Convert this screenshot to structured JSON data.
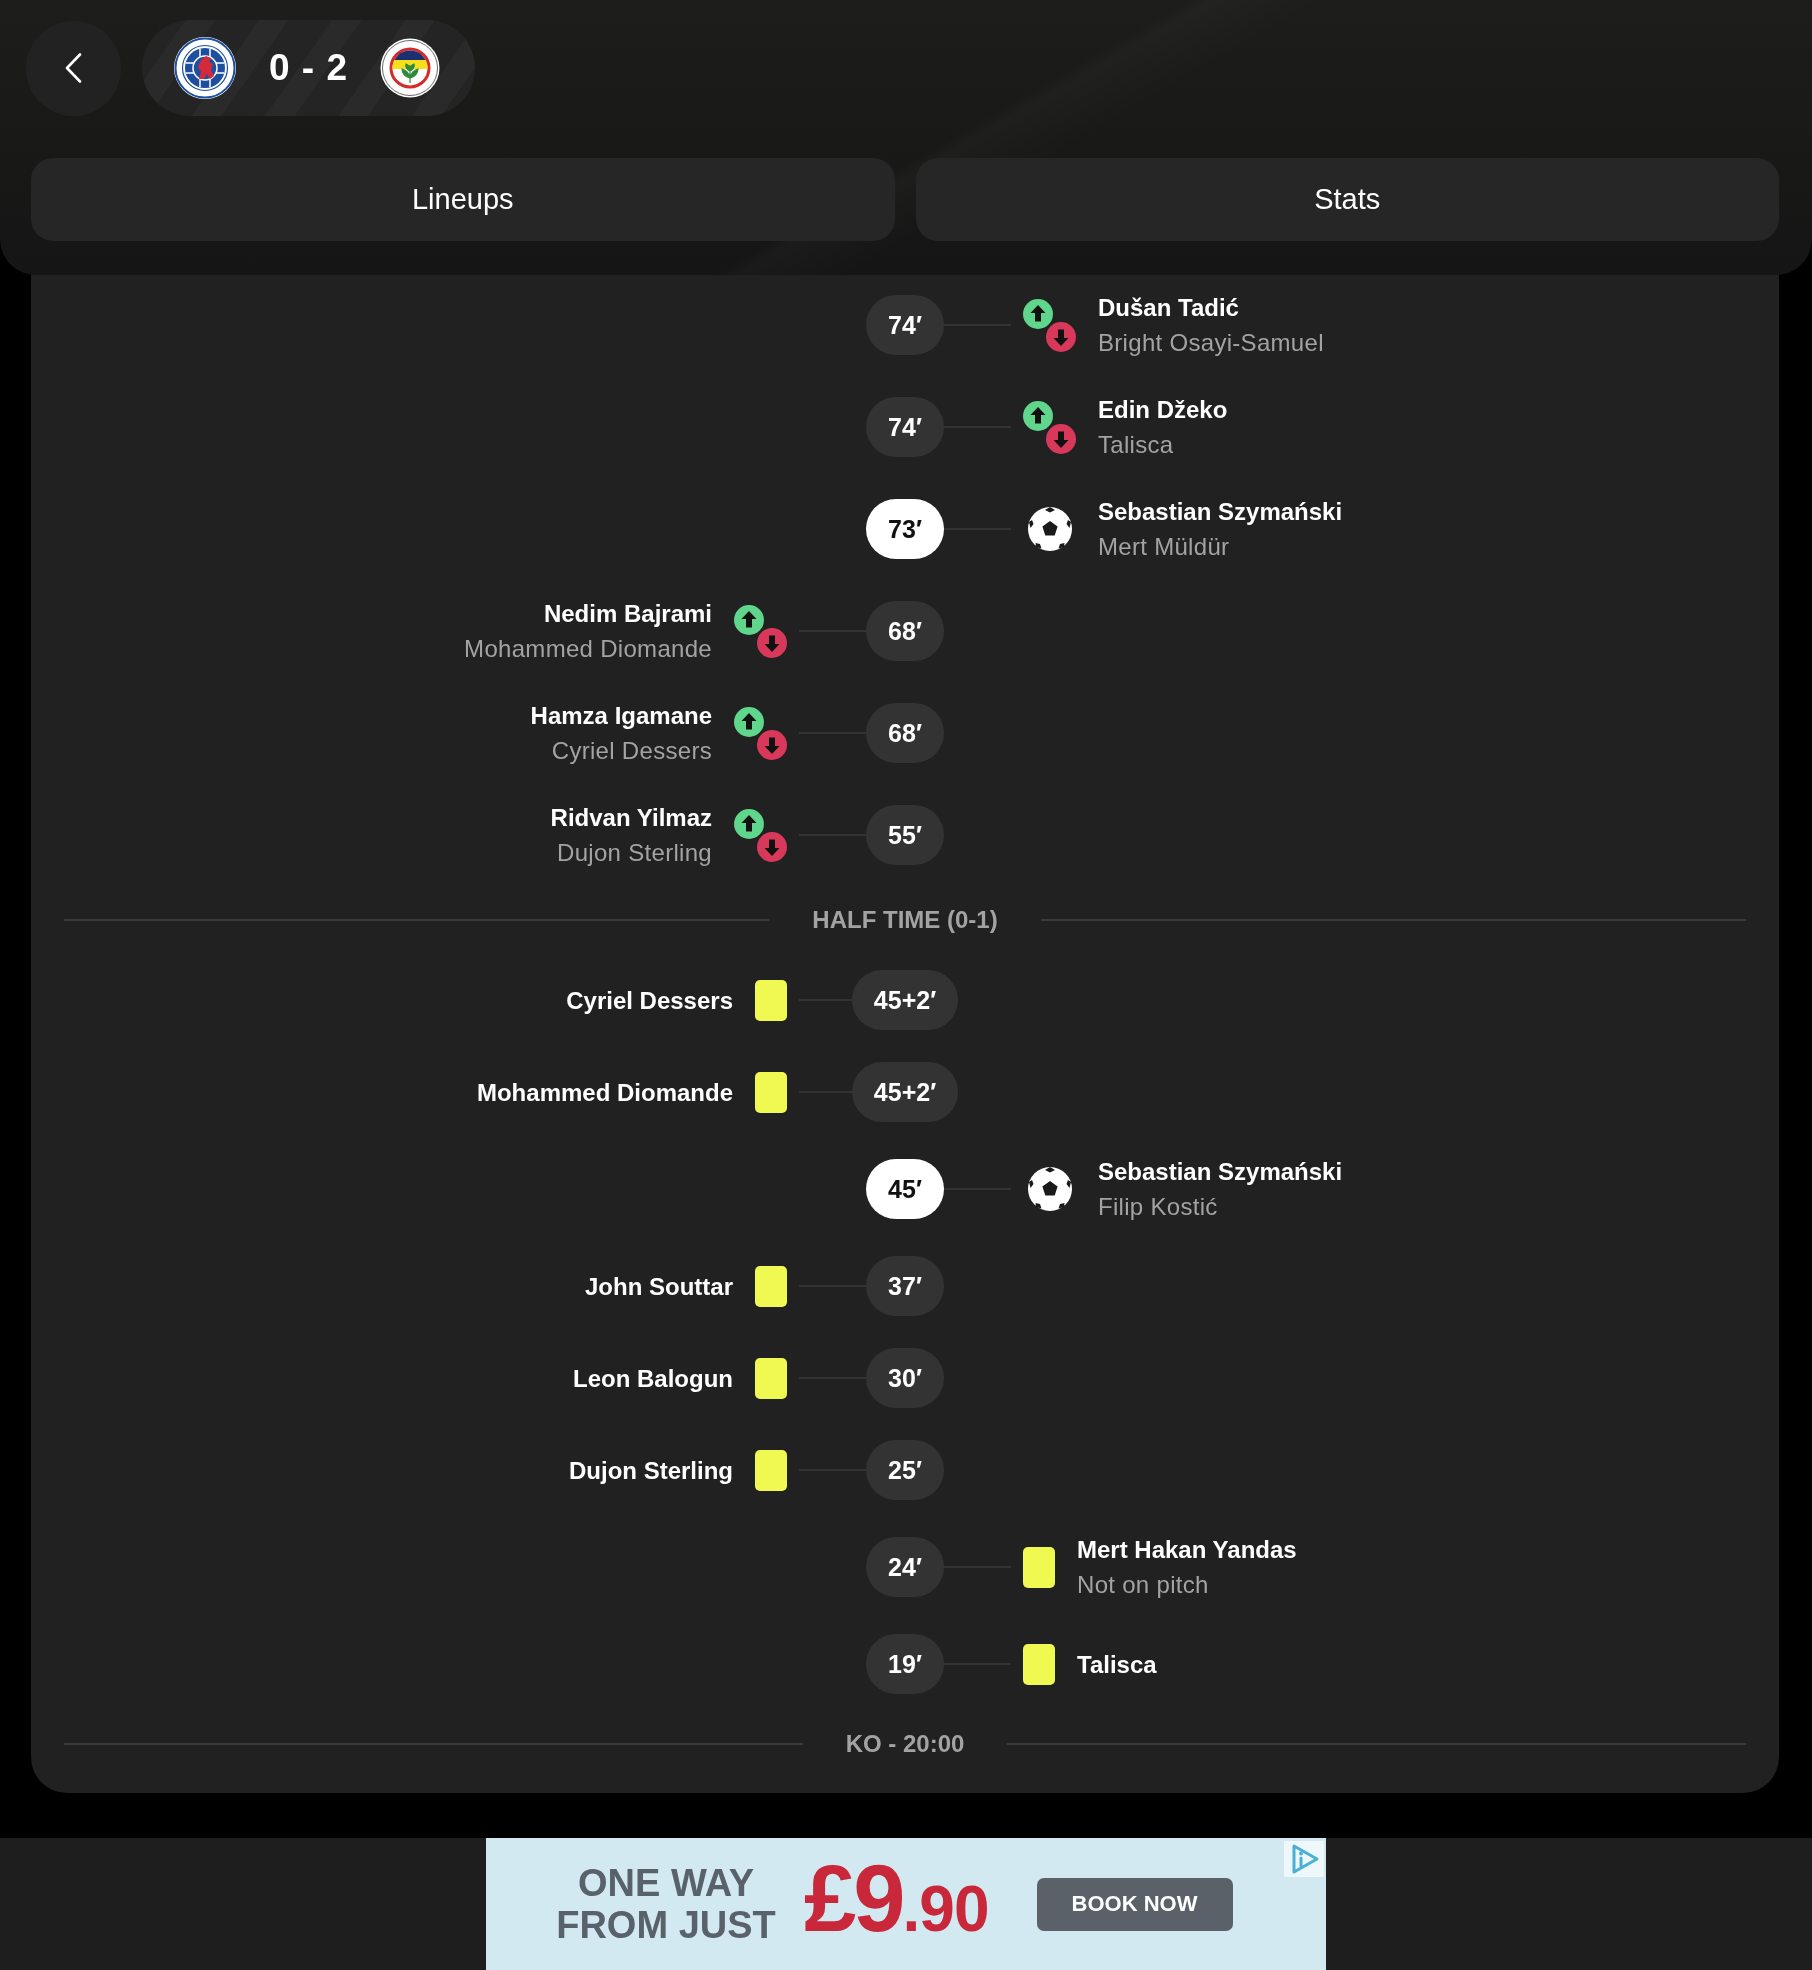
{
  "header": {
    "score": "0 - 2"
  },
  "nav_buttons": [
    {
      "label": "Lineups"
    },
    {
      "label": "Stats"
    }
  ],
  "timeline": [
    {
      "kind": "substitution",
      "away": true,
      "minute": "74′",
      "player_in": "Dušan Tadić",
      "player_out": "Bright Osayi-Samuel"
    },
    {
      "kind": "substitution",
      "away": true,
      "minute": "74′",
      "player_in": "Edin Džeko",
      "player_out": "Talisca"
    },
    {
      "kind": "goal",
      "away": true,
      "minute": "73′",
      "scorer": "Sebastian Szymański",
      "assist": "Mert Müldür"
    },
    {
      "kind": "substitution",
      "away": false,
      "minute": "68′",
      "player_in": "Nedim Bajrami",
      "player_out": "Mohammed Diomande"
    },
    {
      "kind": "substitution",
      "away": false,
      "minute": "68′",
      "player_in": "Hamza Igamane",
      "player_out": "Cyriel Dessers"
    },
    {
      "kind": "substitution",
      "away": false,
      "minute": "55′",
      "player_in": "Ridvan Yilmaz",
      "player_out": "Dujon Sterling"
    },
    {
      "kind": "period",
      "label": "HALF TIME (0-1)"
    },
    {
      "kind": "yellow_card",
      "away": false,
      "minute": "45+2′",
      "player": "Cyriel Dessers"
    },
    {
      "kind": "yellow_card",
      "away": false,
      "minute": "45+2′",
      "player": "Mohammed Diomande"
    },
    {
      "kind": "goal",
      "away": true,
      "minute": "45′",
      "scorer": "Sebastian Szymański",
      "assist": "Filip Kostić"
    },
    {
      "kind": "yellow_card",
      "away": false,
      "minute": "37′",
      "player": "John Souttar"
    },
    {
      "kind": "yellow_card",
      "away": false,
      "minute": "30′",
      "player": "Leon Balogun"
    },
    {
      "kind": "yellow_card",
      "away": false,
      "minute": "25′",
      "player": "Dujon Sterling"
    },
    {
      "kind": "yellow_card",
      "away": true,
      "minute": "24′",
      "player": "Mert Hakan Yandas",
      "note": "Not on pitch"
    },
    {
      "kind": "yellow_card",
      "away": true,
      "minute": "19′",
      "player": "Talisca"
    },
    {
      "kind": "period",
      "label": "KO - 20:00"
    }
  ],
  "ad": {
    "headline": "ONE WAY FROM JUST",
    "price": "£9",
    "price_fraction": ".90",
    "button": "BOOK NOW"
  }
}
